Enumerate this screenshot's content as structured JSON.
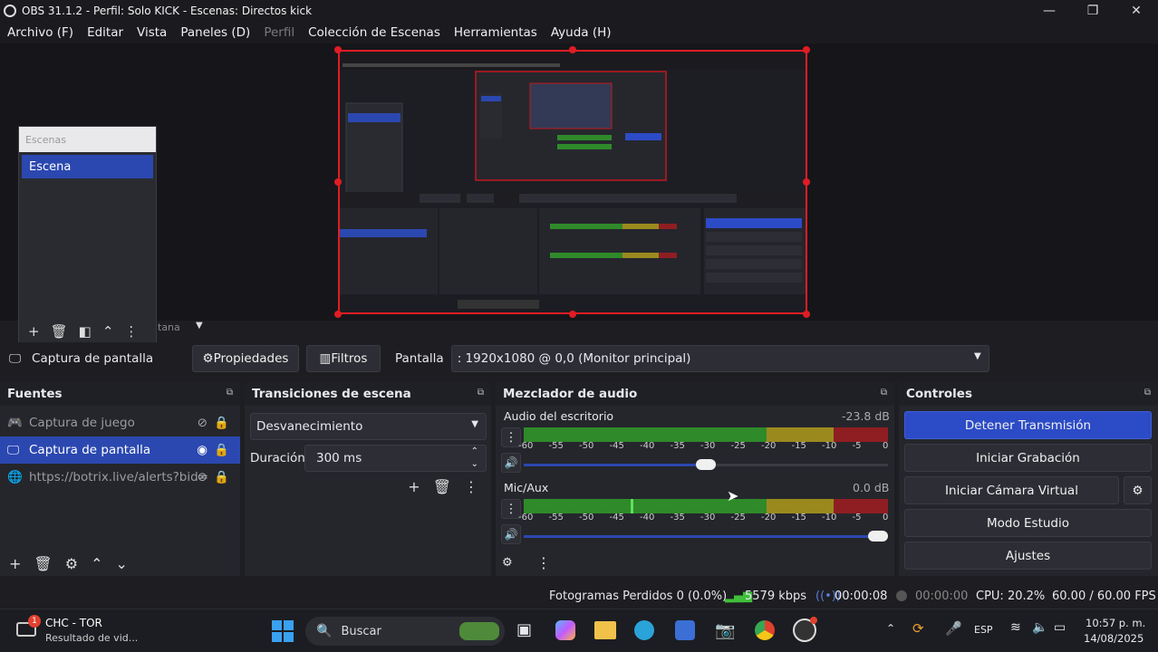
{
  "window": {
    "title": "OBS 31.1.2 - Perfil: Solo KICK - Escenas: Directos kick",
    "minimize": "—",
    "maximize": "❐",
    "close": "✕"
  },
  "menu": {
    "items": [
      "Archivo (F)",
      "Editar",
      "Vista",
      "Paneles (D)",
      "Perfil",
      "Colección de Escenas",
      "Herramientas",
      "Ayuda (H)"
    ]
  },
  "scenes_panel": {
    "header": "Escenas",
    "item": "Escena",
    "behind_label": "tana"
  },
  "source_bar": {
    "source_name": "Captura de pantalla",
    "properties": "Propiedades",
    "filters": "Filtros",
    "display_label": "Pantalla",
    "display_value": ": 1920x1080 @ 0,0 (Monitor principal)"
  },
  "sources": {
    "title": "Fuentes",
    "items": [
      {
        "label": "Captura de juego",
        "selected": false
      },
      {
        "label": "Captura de pantalla",
        "selected": true
      },
      {
        "label": "https://botrix.live/alerts?bid=",
        "selected": false
      }
    ]
  },
  "transitions": {
    "title": "Transiciones de escena",
    "selected": "Desvanecimiento",
    "duration_label": "Duración",
    "duration_value": "300 ms"
  },
  "mixer": {
    "title": "Mezclador de audio",
    "channels": [
      {
        "name": "Audio del escritorio",
        "db": "-23.8 dB",
        "volume": 0.5
      },
      {
        "name": "Mic/Aux",
        "db": "0.0 dB",
        "volume": 1.0
      }
    ],
    "scale": [
      "-60",
      "-55",
      "-50",
      "-45",
      "-40",
      "-35",
      "-30",
      "-25",
      "-20",
      "-15",
      "-10",
      "-5",
      "0"
    ]
  },
  "controls": {
    "title": "Controles",
    "stop_stream": "Detener Transmisión",
    "start_recording": "Iniciar Grabación",
    "virtual_cam": "Iniciar Cámara Virtual",
    "studio_mode": "Modo Estudio",
    "settings": "Ajustes"
  },
  "status": {
    "dropped": "Fotogramas Perdidos 0 (0.0%)",
    "bitrate": "5579 kbps",
    "stream_time": "00:00:08",
    "rec_time": "00:00:00",
    "cpu": "CPU: 20.2%",
    "fps": "60.00 / 60.00 FPS"
  },
  "taskbar": {
    "weather_title": "CHC - TOR",
    "weather_sub": "Resultado de vid...",
    "badge": "1",
    "search": "Buscar",
    "lang": "ESP",
    "time": "10:57 p. m.",
    "date": "14/08/2025"
  },
  "colors": {
    "accent": "#2b48b0",
    "stop_button": "#2c4bc6",
    "meter_green": "#2f8a2a",
    "meter_yellow": "#9a8a1e",
    "meter_red": "#8f1e22",
    "canvas_border": "#e01c24"
  }
}
